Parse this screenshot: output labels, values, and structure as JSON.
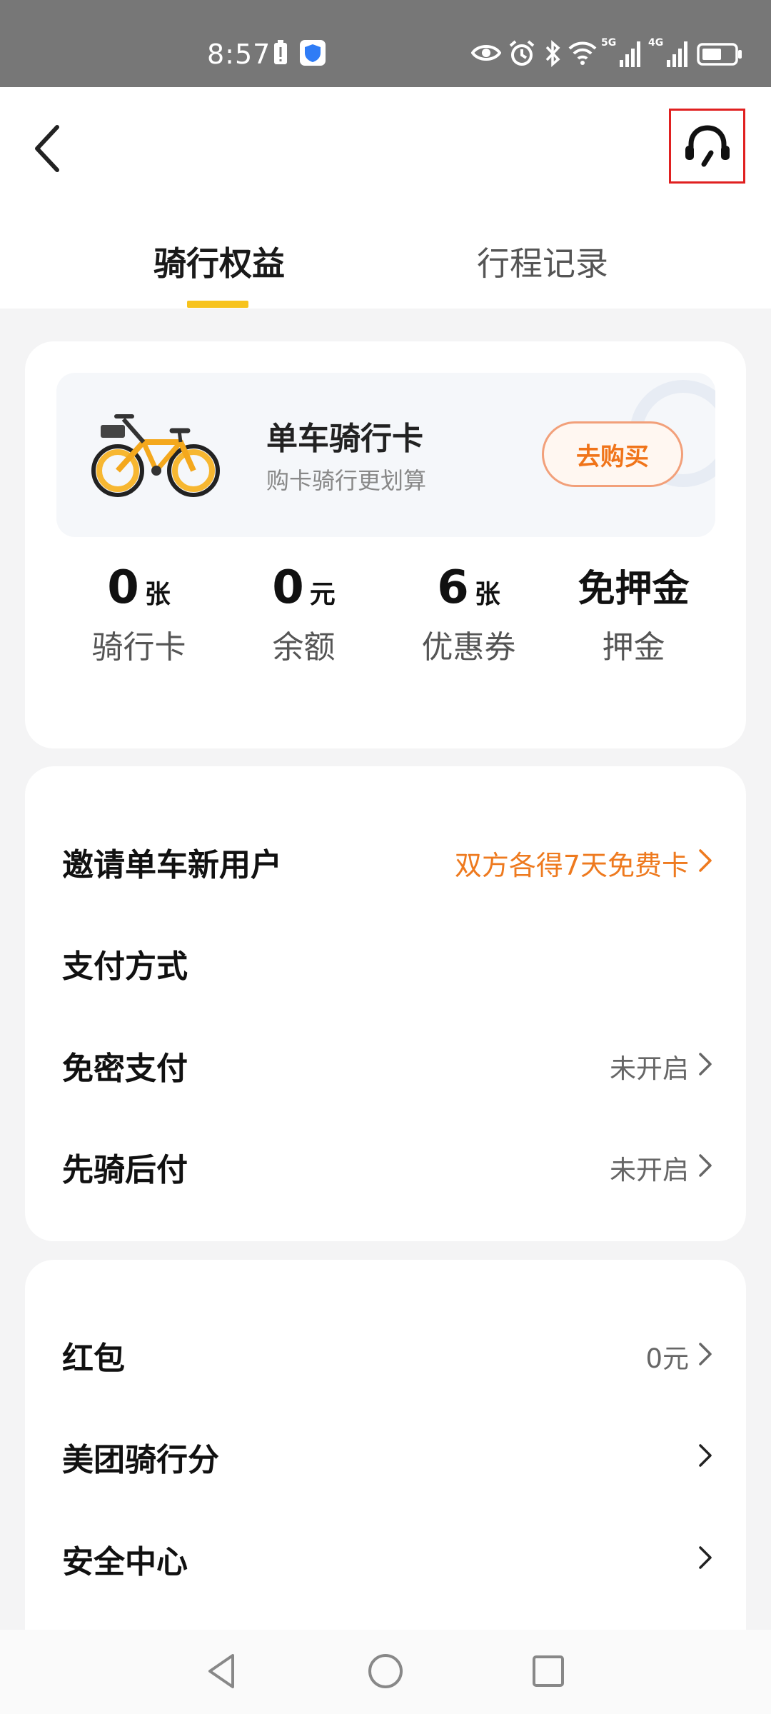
{
  "status_bar": {
    "time": "8:57",
    "icons": [
      "battery-alert-icon",
      "shield-icon",
      "eye-icon",
      "alarm-icon",
      "bluetooth-icon",
      "wifi-icon",
      "signal-5g-icon",
      "signal-4g-icon",
      "battery-icon"
    ],
    "signal_labels": [
      "5G",
      "4G"
    ]
  },
  "nav": {
    "back_icon": "chevron-left-icon",
    "support_icon": "headset-icon"
  },
  "tabs": [
    {
      "label": "骑行权益",
      "active": true
    },
    {
      "label": "行程记录",
      "active": false
    }
  ],
  "colors": {
    "accent": "#f7c31d",
    "orange": "#ee7a1f",
    "highlight_box": "#e02020"
  },
  "promo": {
    "title": "单车骑行卡",
    "subtitle": "购卡骑行更划算",
    "button": "去购买"
  },
  "stats": [
    {
      "value": "0",
      "unit": "张",
      "label": "骑行卡"
    },
    {
      "value": "0",
      "unit": "元",
      "label": "余额"
    },
    {
      "value": "6",
      "unit": "张",
      "label": "优惠券"
    },
    {
      "text": "免押金",
      "label": "押金"
    }
  ],
  "settings": [
    {
      "label": "邀请单车新用户",
      "value": "双方各得7天免费卡",
      "accent": true
    },
    {
      "label": "支付方式",
      "value": ""
    },
    {
      "label": "免密支付",
      "value": "未开启"
    },
    {
      "label": "先骑后付",
      "value": "未开启"
    }
  ],
  "more": [
    {
      "label": "红包",
      "value": "0元"
    },
    {
      "label": "美团骑行分",
      "value": ""
    },
    {
      "label": "安全中心",
      "value": ""
    }
  ]
}
